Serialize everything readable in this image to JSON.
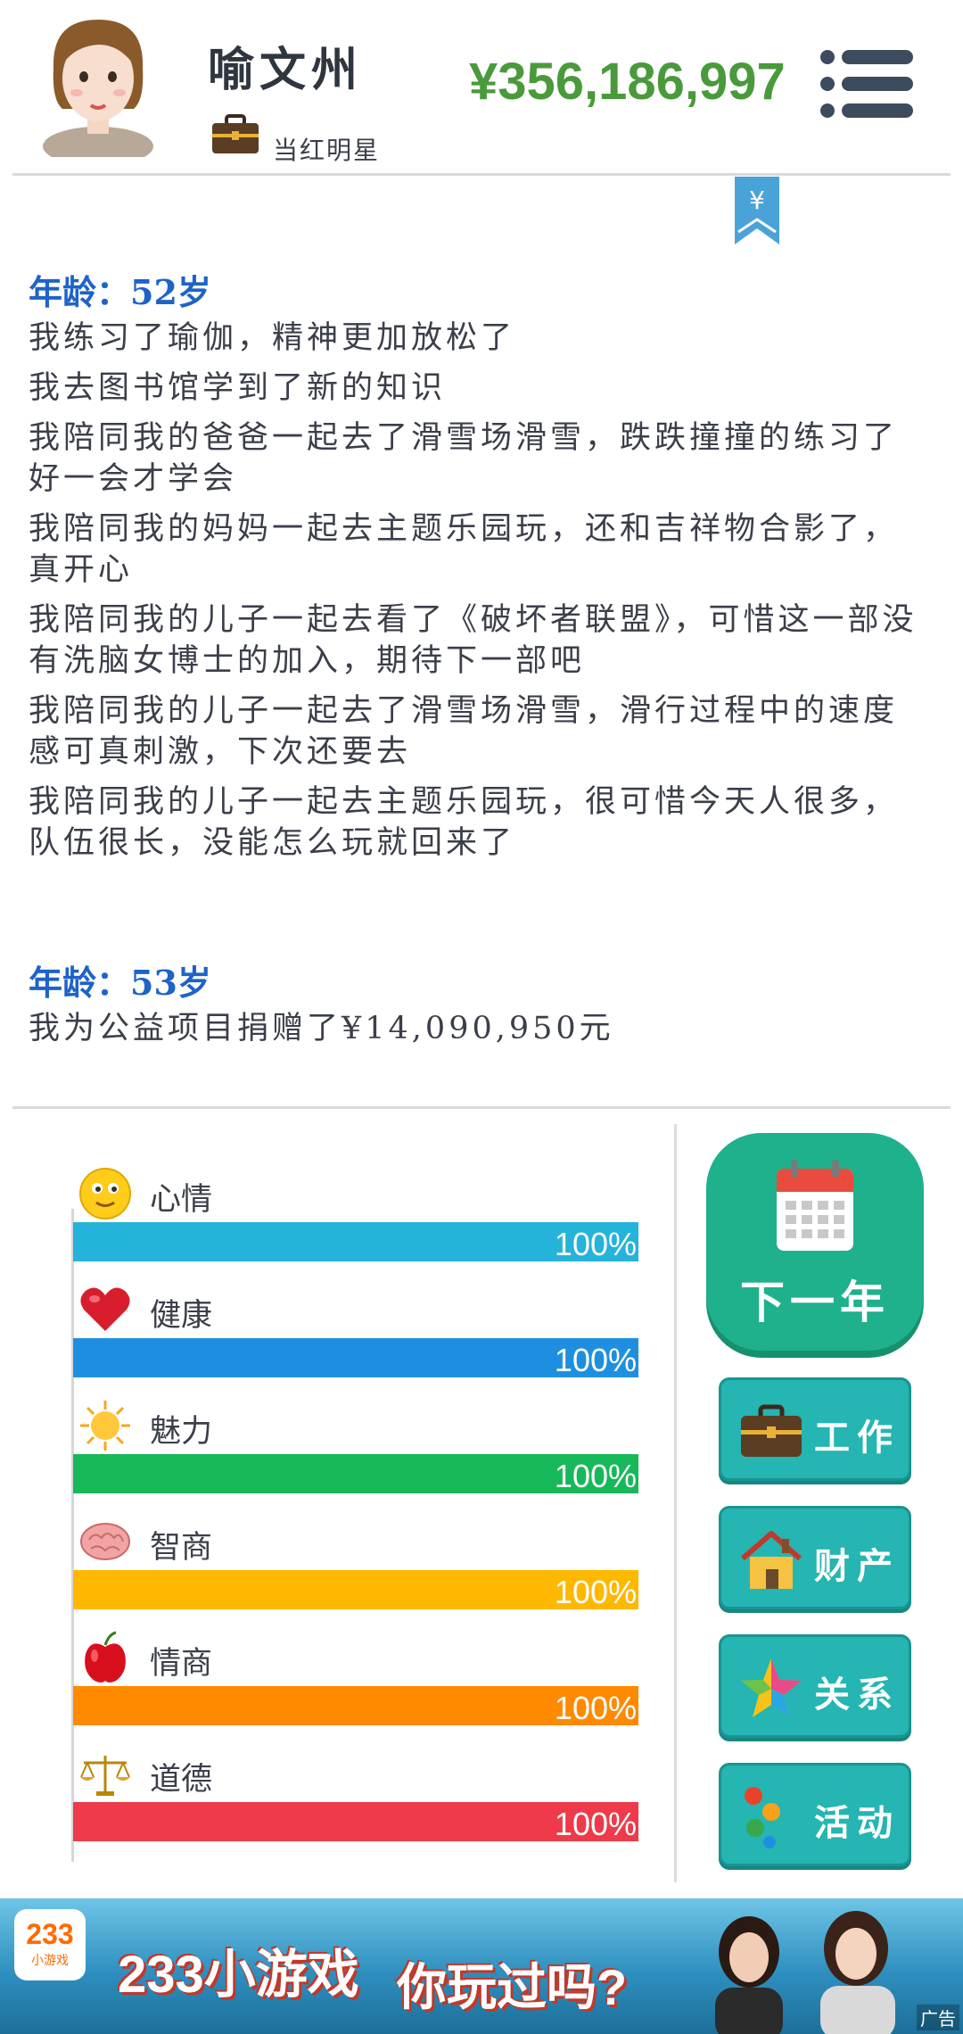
{
  "header": {
    "name": "喻文州",
    "job_title": "当红明星",
    "money": "¥356,186,997"
  },
  "log": {
    "sections": [
      {
        "age": "年龄：52岁",
        "entries": [
          "我练习了瑜伽，精神更加放松了",
          "我去图书馆学到了新的知识",
          "我陪同我的爸爸一起去了滑雪场滑雪，跌跌撞撞的练习了好一会才学会",
          "我陪同我的妈妈一起去主题乐园玩，还和吉祥物合影了，真开心",
          "我陪同我的儿子一起去看了《破坏者联盟》，可惜这一部没有洗脑女博士的加入，期待下一部吧",
          "我陪同我的儿子一起去了滑雪场滑雪，滑行过程中的速度感可真刺激，下次还要去",
          "我陪同我的儿子一起去主题乐园玩，很可惜今天人很多，队伍很长，没能怎么玩就回来了"
        ]
      },
      {
        "age": "年龄：53岁",
        "entries": [
          "我为公益项目捐赠了¥14,090,950元"
        ]
      }
    ]
  },
  "stats": [
    {
      "label": "心情",
      "value": 100,
      "pct": "100%",
      "color": "#24b3d9",
      "icon": "smiley-icon"
    },
    {
      "label": "健康",
      "value": 100,
      "pct": "100%",
      "color": "#1e8fe0",
      "icon": "heart-icon"
    },
    {
      "label": "魅力",
      "value": 100,
      "pct": "100%",
      "color": "#17b85a",
      "icon": "sun-icon"
    },
    {
      "label": "智商",
      "value": 100,
      "pct": "100%",
      "color": "#ffb800",
      "icon": "brain-icon"
    },
    {
      "label": "情商",
      "value": 100,
      "pct": "100%",
      "color": "#ff8a00",
      "icon": "apple-icon"
    },
    {
      "label": "道德",
      "value": 100,
      "pct": "100%",
      "color": "#ee3a4a",
      "icon": "scales-icon"
    }
  ],
  "actions": {
    "next_year": "下一年",
    "work": "工作",
    "assets": "财产",
    "relations": "关系",
    "activities": "活动"
  },
  "ad": {
    "logo_num": "233",
    "logo_sub": "小游戏",
    "headline_1": "233小游戏",
    "headline_2": "你玩过吗?",
    "tag": "广告"
  }
}
